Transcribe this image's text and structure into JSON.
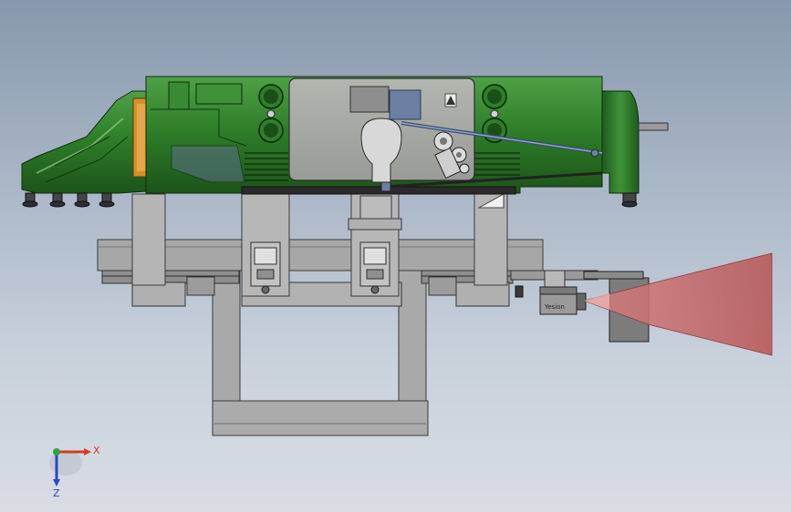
{
  "viewport": {
    "background_top": "#8797ad",
    "background_bottom": "#d8dde4"
  },
  "triad": {
    "x_label": "X",
    "z_label": "Z",
    "x_color": "#d83a2c",
    "z_color": "#2a48c9",
    "y_color": "#2fa33a"
  },
  "labels": {
    "camera_brand": "Yesion"
  },
  "colors": {
    "housing_green": "#2f7f2a",
    "housing_dark": "#1e5a1a",
    "cover_gray": "#a6a8a4",
    "frame_gray": "#a9a9a9",
    "orange_plate": "#d6902a",
    "light_cone": "#c96a6a"
  },
  "icons": {
    "triad": "coordinate-triad-icon",
    "warning": "warning-sign-icon"
  }
}
